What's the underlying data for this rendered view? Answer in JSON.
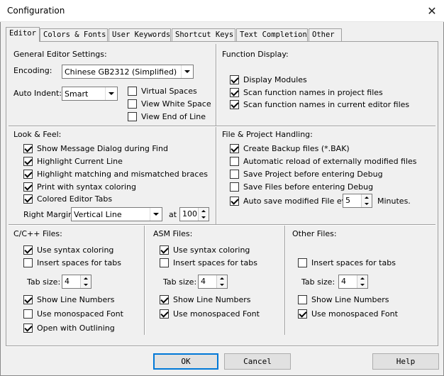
{
  "window": {
    "title": "Configuration",
    "close_glyph": "✕"
  },
  "tabs": [
    "Editor",
    "Colors & Fonts",
    "User Keywords",
    "Shortcut Keys",
    "Text Completion",
    "Other"
  ],
  "general": {
    "heading": "General Editor Settings:",
    "encoding_label": "Encoding:",
    "encoding_value": "Chinese GB2312 (Simplified)",
    "indent_label": "Auto Indent:",
    "indent_value": "Smart",
    "virtual_spaces": "Virtual Spaces",
    "view_white_space": "View White Space",
    "view_eol": "View End of Line"
  },
  "function_display": {
    "heading": "Function Display:",
    "items": [
      "Display Modules",
      "Scan function names in project files",
      "Scan function names in current editor files"
    ]
  },
  "look_feel": {
    "heading": "Look & Feel:",
    "items": [
      "Show Message Dialog during Find",
      "Highlight Current Line",
      "Highlight matching and mismatched braces",
      "Print with syntax coloring",
      "Colored Editor Tabs"
    ],
    "margin_label": "Right Margin:",
    "margin_value": "Vertical Line",
    "at_label": "at",
    "at_value": "100"
  },
  "file_handling": {
    "heading": "File & Project Handling:",
    "items": [
      "Create Backup files (*.BAK)",
      "Automatic reload of externally modified files",
      "Save Project before entering Debug",
      "Save Files before entering Debug",
      "Auto save modified File every"
    ],
    "autosave_value": "5",
    "minutes_label": "Minutes."
  },
  "cpp": {
    "heading": "C/C++ Files:",
    "syntax": "Use syntax coloring",
    "insert_spaces": "Insert spaces for tabs",
    "tab_label": "Tab size:",
    "tab_value": "4",
    "line_numbers": "Show Line Numbers",
    "mono": "Use monospaced Font",
    "outlining": "Open with Outlining"
  },
  "asm": {
    "heading": "ASM Files:",
    "syntax": "Use syntax coloring",
    "insert_spaces": "Insert spaces for tabs",
    "tab_label": "Tab size:",
    "tab_value": "4",
    "line_numbers": "Show Line Numbers",
    "mono": "Use monospaced Font"
  },
  "other": {
    "heading": "Other Files:",
    "insert_spaces": "Insert spaces for tabs",
    "tab_label": "Tab size:",
    "tab_value": "4",
    "line_numbers": "Show Line Numbers",
    "mono": "Use monospaced Font"
  },
  "buttons": {
    "ok": "OK",
    "cancel": "Cancel",
    "help": "Help"
  }
}
